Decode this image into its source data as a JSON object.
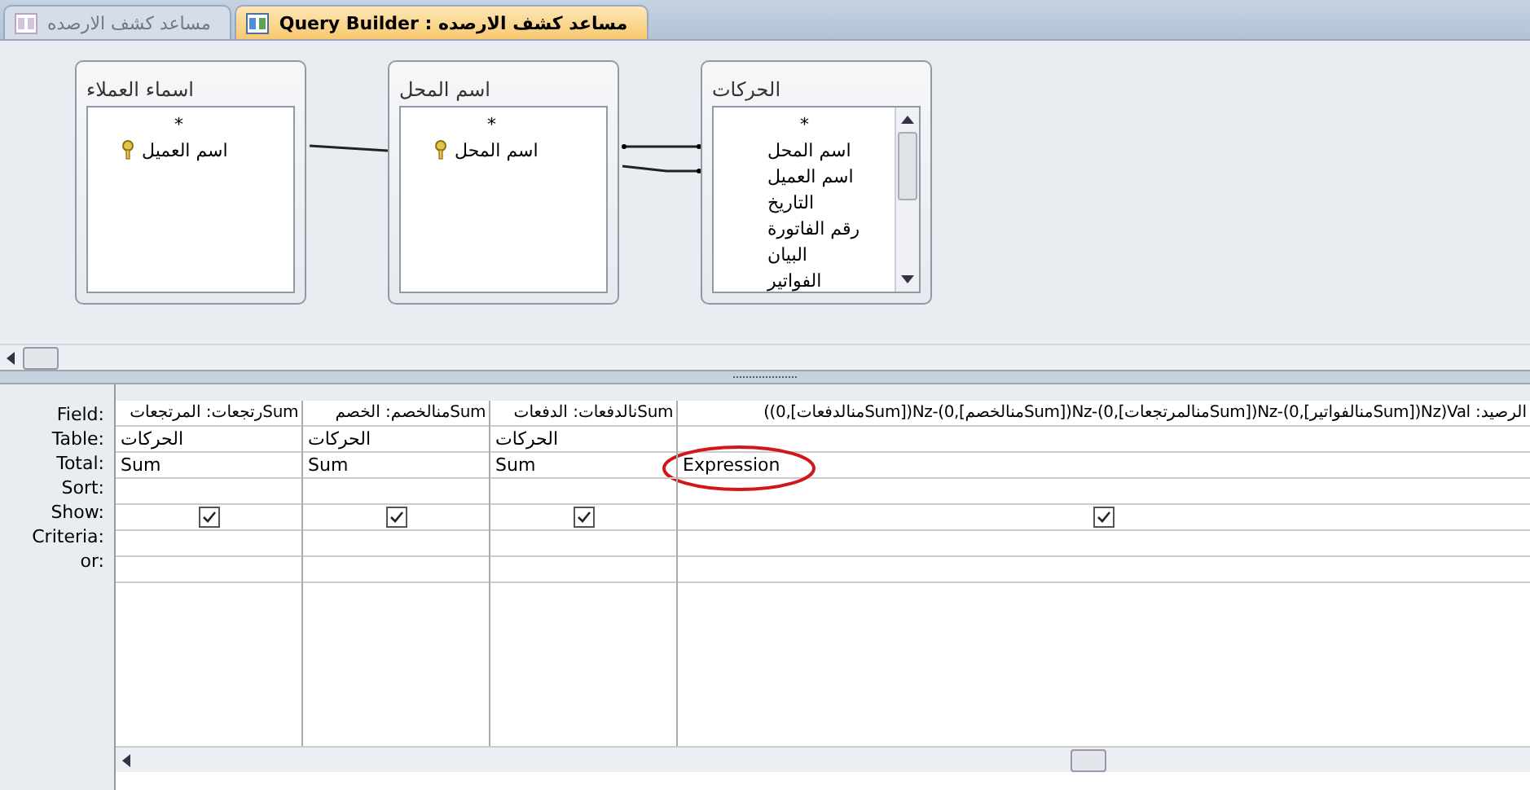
{
  "tabs": [
    {
      "label": "Query Builder : مساعد كشف الارصده",
      "selected": true
    },
    {
      "label": "مساعد كشف الارصده",
      "selected": false
    }
  ],
  "tables": [
    {
      "title": "الحركات",
      "fields": [
        {
          "name": "*",
          "key": false
        },
        {
          "name": "اسم المحل",
          "key": false
        },
        {
          "name": "اسم العميل",
          "key": false
        },
        {
          "name": "التاريخ",
          "key": false
        },
        {
          "name": "رقم الفاتورة",
          "key": false
        },
        {
          "name": "البيان",
          "key": false
        },
        {
          "name": "الفواتير",
          "key": false
        }
      ]
    },
    {
      "title": "اسم المحل",
      "fields": [
        {
          "name": "*",
          "key": false
        },
        {
          "name": "اسم المحل",
          "key": true
        }
      ]
    },
    {
      "title": "اسماء العملاء",
      "fields": [
        {
          "name": "*",
          "key": false
        },
        {
          "name": "اسم العميل",
          "key": true
        }
      ]
    }
  ],
  "grid": {
    "row_labels": [
      "Field:",
      "Table:",
      "Total:",
      "Sort:",
      "Show:",
      "Criteria:",
      "or:"
    ],
    "columns": [
      {
        "field": "الرصيد: Val(Nz([Sumمنالفواتير],0)-Nz([Sumمنالمرتجعات],0)-Nz([Sumمنالخصم],0)-Nz([Sumمنالدفعات],0))",
        "total": "Expression",
        "show": true,
        "circled": true
      },
      {
        "field": "Sumنالدفعات: الدفعات",
        "table": "الحركات",
        "total": "Sum",
        "show": true,
        "circled": false
      },
      {
        "field": "Sumمنالخصم: الخصم",
        "table": "الحركات",
        "total": "Sum",
        "show": true,
        "circled": false
      },
      {
        "field": "Sumرتجعات: المرتجعات",
        "table": "الحركات",
        "total": "Sum",
        "show": true,
        "circled": false
      }
    ]
  }
}
